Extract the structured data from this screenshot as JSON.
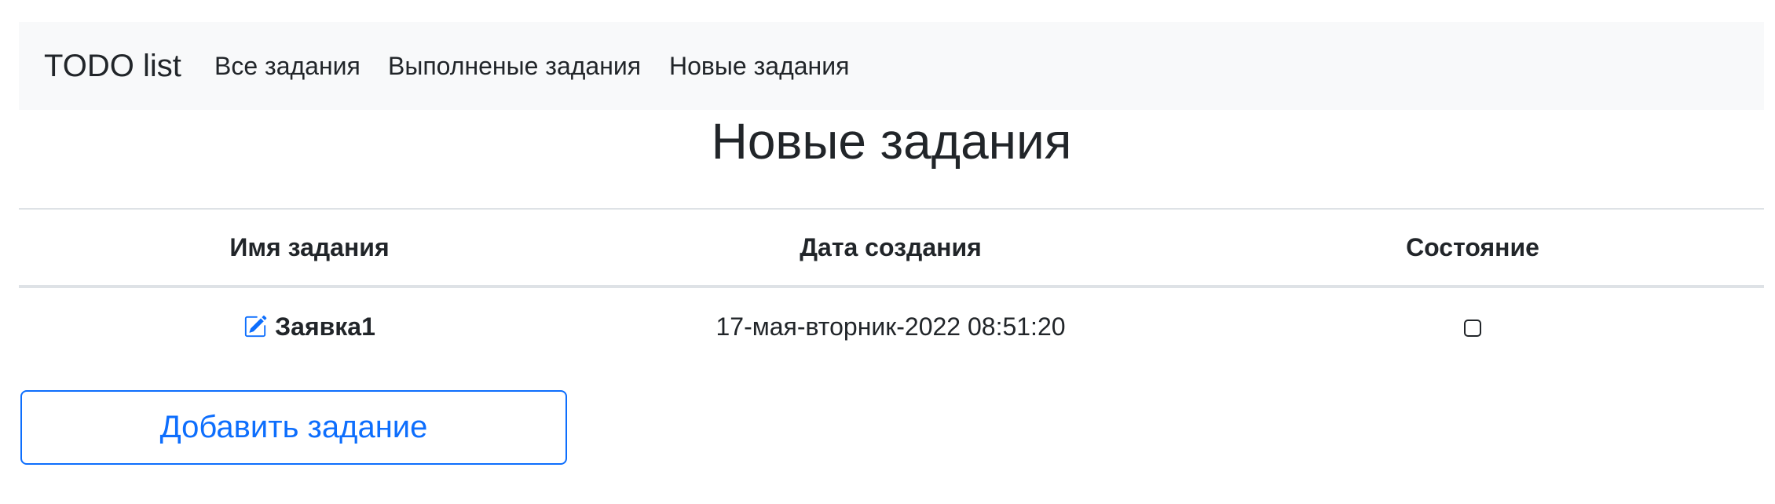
{
  "navbar": {
    "brand": "TODO list",
    "links": [
      {
        "label": "Все задания"
      },
      {
        "label": "Выполненые задания"
      },
      {
        "label": "Новые задания"
      }
    ]
  },
  "page": {
    "title": "Новые задания"
  },
  "table": {
    "headers": [
      "Имя задания",
      "Дата создания",
      "Состояние"
    ],
    "rows": [
      {
        "name": "Заявка1",
        "created": "17-мая-вторник-2022 08:51:20",
        "done": false,
        "edit_icon": "edit-square-pen-icon"
      }
    ]
  },
  "actions": {
    "add_label": "Добавить задание"
  },
  "colors": {
    "navbar_bg": "#f8f9fa",
    "accent": "#0d6efd",
    "text": "#212529",
    "border": "#dee2e6"
  }
}
